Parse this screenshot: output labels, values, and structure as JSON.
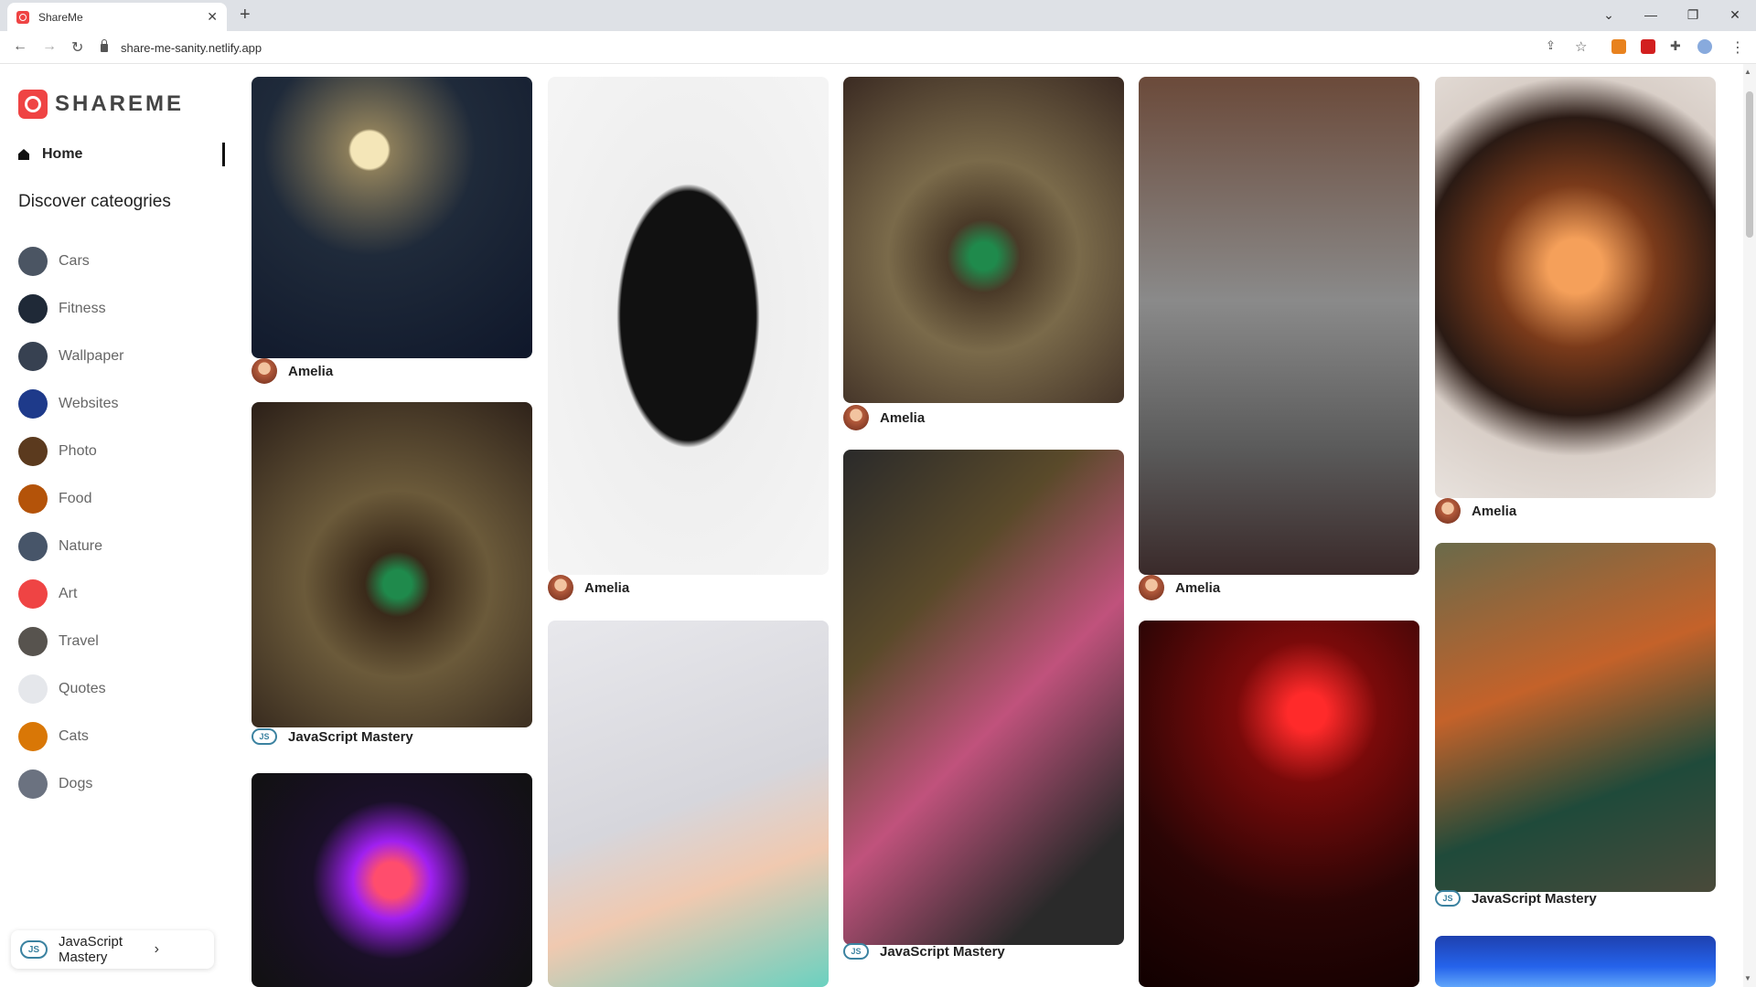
{
  "browser": {
    "tab_title": "ShareMe",
    "tab_close": "✕",
    "new_tab": "+",
    "url": "share-me-sanity.netlify.app",
    "window_controls": [
      "⌄",
      "—",
      "❐",
      "✕"
    ]
  },
  "sidebar": {
    "logo": "SHAREME",
    "home": "Home",
    "discover_title": "Discover cateogries",
    "categories": [
      {
        "label": "Cars",
        "color": "#4b5563"
      },
      {
        "label": "Fitness",
        "color": "#1f2937"
      },
      {
        "label": "Wallpaper",
        "color": "#374151"
      },
      {
        "label": "Websites",
        "color": "#1e3a8a"
      },
      {
        "label": "Photo",
        "color": "#5b3a1e"
      },
      {
        "label": "Food",
        "color": "#b45309"
      },
      {
        "label": "Nature",
        "color": "#475569"
      },
      {
        "label": "Art",
        "color": "#ef4444"
      },
      {
        "label": "Travel",
        "color": "#57534e"
      },
      {
        "label": "Quotes",
        "color": "#e5e7eb"
      },
      {
        "label": "Cats",
        "color": "#d97706"
      },
      {
        "label": "Dogs",
        "color": "#6b7280"
      }
    ],
    "footer_user": "JavaScript Mastery",
    "footer_chevron": "›"
  },
  "pins": [
    {
      "user": "Amelia",
      "js": false,
      "bg": "radial-gradient(circle at 42% 26%, #f4e6b8 0 7%, #8b7d5a 8%, #1f2a3a 40%, #0f172a 100%)"
    },
    {
      "user": "JavaScript Mastery",
      "js": true,
      "bg": "radial-gradient(circle at 52% 56%, #1f8a4c 0 6%, #3a2a1a 14%, #6b5a3a 40%, #2b1f18 100%)"
    },
    {
      "user": "",
      "js": false,
      "bg": "radial-gradient(circle at 50% 50%, #ff4d6d 0 10%, #a020f0 22%, #1a1028 45%, #111 100%)"
    },
    {
      "user": "Amelia",
      "js": false,
      "bg": "radial-gradient(ellipse at 50% 48%, #111 0 34%, #eeeeee 36%, #f5f5f5 100%)"
    },
    {
      "user": "",
      "js": false,
      "bg": "linear-gradient(160deg, #e8e8ec 0%, #d6d6dc 50%, #f0c9b0 70%, #6ad1c0 100%)"
    },
    {
      "user": "Amelia",
      "js": false,
      "bg": "radial-gradient(circle at 50% 55%, #1f8a4c 0 6%, #4a3a28 16%, #7a6a4a 42%, #3a2a22 100%)"
    },
    {
      "user": "JavaScript Mastery",
      "js": true,
      "bg": "linear-gradient(135deg, #2a2a2a 0%, #5a4a2a 30%, #c0527c 55%, #2a2a2a 85%)"
    },
    {
      "user": "Amelia",
      "js": false,
      "bg": "linear-gradient(180deg, #6b4a3a 0%, #8a8a8a 45%, #5a5a5a 75%, #3a2a2a 100%)"
    },
    {
      "user": "",
      "js": false,
      "bg": "radial-gradient(circle at 60% 25%, #ff2a2a 0 6%, #7a0a0a 22%, #2a0505 60%, #100 100%)"
    },
    {
      "user": "Amelia",
      "js": false,
      "bg": "radial-gradient(circle at 50% 45%, #f5a05a 0 10%, #7a3a1a 30%, #2a1a14 55%, #d9cfc8 70%, #e8e2dd 100%)"
    },
    {
      "user": "JavaScript Mastery",
      "js": true,
      "bg": "linear-gradient(160deg, #6a6a4a 0%, #c4622a 40%, #1f4a3a 70%, #4a4a3a 100%)"
    },
    {
      "user": "",
      "js": false,
      "bg": "linear-gradient(180deg, #1e40af 0%, #2563eb 60%, #60a5fa 100%)"
    }
  ]
}
